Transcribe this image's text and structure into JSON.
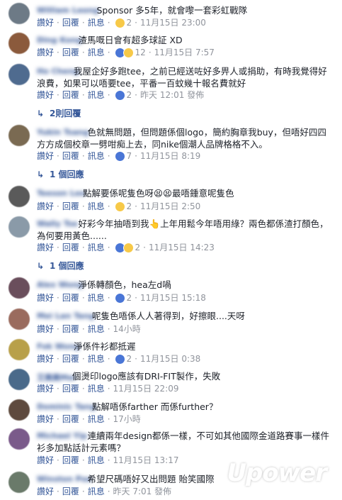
{
  "comments": [
    {
      "author": "William Leong",
      "text": "Sponsor 多5年，就會嚟一套彩虹戰隊",
      "reactions": [
        "haha"
      ],
      "count": "2",
      "time": "11月15日 23:00",
      "avatar_color": "#6d7a86"
    },
    {
      "author": "Ding Kong",
      "text": "渣馬嘅日會有超多球証 XD",
      "reactions": [
        "like",
        "haha"
      ],
      "count": "12",
      "time": "11月15日 7:57",
      "avatar_color": "#8b5a3c"
    },
    {
      "author": "Ho Cheng",
      "text": "我屋企好多跑tee，之前已經送咗好多畀人或捐助，有時我覺得好浪費，如果可以唔要tee，平番一百蚊幾十報名費就好",
      "reactions": [
        "like"
      ],
      "count": "2",
      "time": "昨天 12:01 發佈",
      "avatar_color": "#4f6b8f",
      "replies": "2則回覆"
    },
    {
      "author": "Yukin Tsang",
      "text": "色就無問題，但問題係個logo，簡約胸章我buy，但唔好四四方方成個校章一劈咁痴上去，同nike個潮人品牌格格不入。",
      "reactions": [
        "like"
      ],
      "count": "7",
      "time": "11月15日 8:19",
      "avatar_color": "#7a6a52",
      "replies": "1 個回應"
    },
    {
      "author": "Teeson Lee",
      "text": "點解要係呢隻色呀😫😫最唔鍾意呢隻色",
      "reactions": [
        "sad"
      ],
      "count": "2",
      "time": "11月15日 2:50",
      "avatar_color": "#5a5a5a"
    },
    {
      "author": "Wally Tse",
      "text": "好彩今年抽唔到我👆上年用鬆今年唔用綠？兩色都係渣打顏色，為何要用黃色......",
      "reactions": [
        "like",
        "haha"
      ],
      "count": "2",
      "time": "11月15日 14:23",
      "avatar_color": "#8a9aa8",
      "replies": "1 個回應"
    },
    {
      "author": "Alex Wong",
      "text": "淨係轉顏色，hea左d喎",
      "reactions": [
        "like"
      ],
      "count": "2",
      "time": "11月15日 15:18",
      "avatar_color": "#6a4e5c"
    },
    {
      "author": "Mei Lan Tang",
      "text": "呢隻色唔係人人著得到，好擦眼....天呀",
      "reactions": [],
      "count": "",
      "time": "14小時",
      "avatar_color": "#9a6b5e"
    },
    {
      "author": "Fok Wong",
      "text": "淨係件衫都抵遲",
      "reactions": [
        "like"
      ],
      "count": "2",
      "time": "11月15日 0:38",
      "avatar_color": "#b8a04a"
    },
    {
      "author": "艾美美Mei",
      "text": "個燙印logo應該有DRI-FIT製作，失敗",
      "reactions": [],
      "count": "",
      "time": "11月15日 22:09",
      "avatar_color": "#4a6a8a"
    },
    {
      "author": "Dominic Tang",
      "text": "點解唔係farther 而係further？",
      "reactions": [],
      "count": "",
      "time": "17小時",
      "avatar_color": "#5e4a3e"
    },
    {
      "author": "Michael Yip",
      "text": "連續兩年design都係一樣，不可如其他國際金道路賽事一樣件衫多加點話計元素嗎？",
      "reactions": [],
      "count": "",
      "time": "11月15日 13:17",
      "avatar_color": "#7a5a8a"
    },
    {
      "author": "Winston Poe",
      "text": "希望尺碼唔好又出問題 貽笑國際",
      "reactions": [],
      "count": "",
      "time": "昨天 7:01 發佈",
      "avatar_color": "#6a7a6a"
    }
  ],
  "labels": {
    "like": "讚好",
    "reply": "回覆",
    "message": "訊息"
  },
  "watermark": "Upower"
}
